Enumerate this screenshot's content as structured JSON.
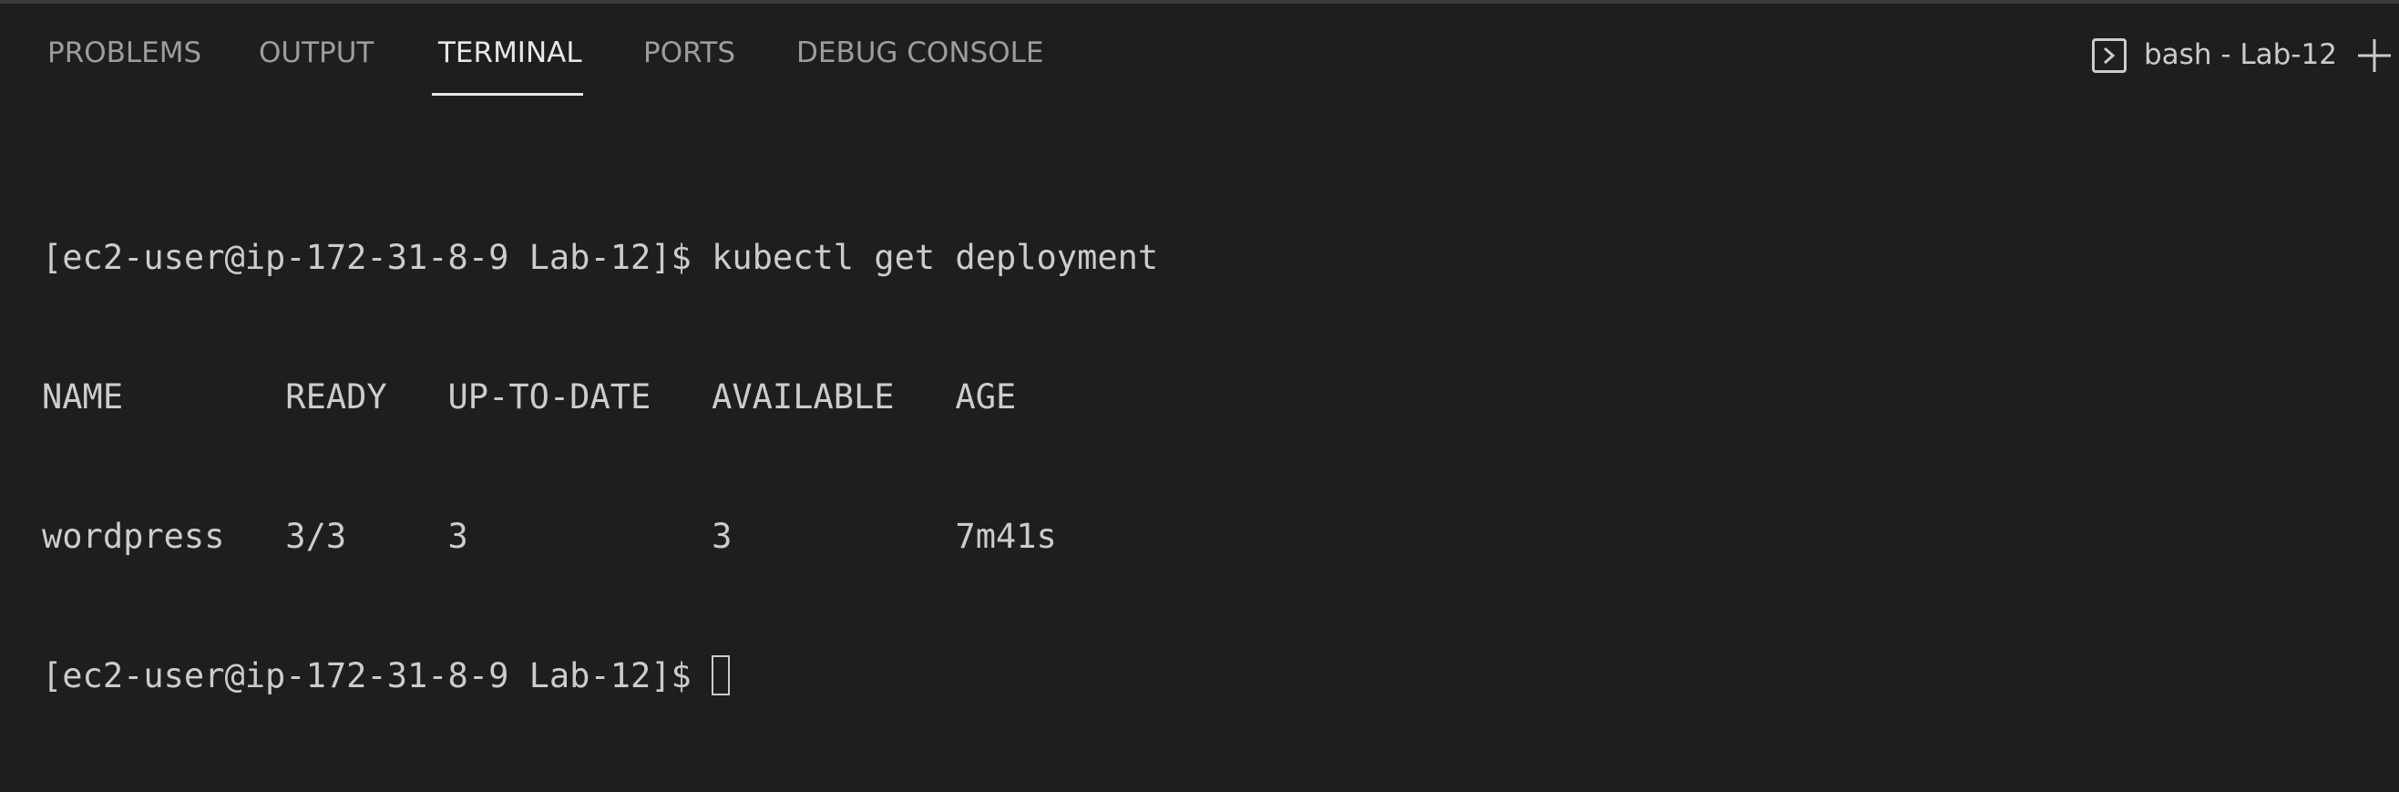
{
  "tabs": [
    {
      "label": "PROBLEMS"
    },
    {
      "label": "OUTPUT"
    },
    {
      "label": "TERMINAL"
    },
    {
      "label": "PORTS"
    },
    {
      "label": "DEBUG CONSOLE"
    }
  ],
  "active_tab": "TERMINAL",
  "terminal_instance": {
    "title": "bash - Lab-12",
    "icon": "terminal-icon"
  },
  "new_terminal_icon": "plus-icon",
  "terminal": {
    "prompt1": "[ec2-user@ip-172-31-8-9 Lab-12]$ ",
    "command1": "kubectl get deployment",
    "header": "NAME        READY   UP-TO-DATE   AVAILABLE   AGE",
    "row1": "wordpress   3/3     3            3           7m41s",
    "prompt2": "[ec2-user@ip-172-31-8-9 Lab-12]$ "
  },
  "colors": {
    "background": "#1e1e1e",
    "text": "#cccccc",
    "tab_inactive": "#9d9d9d",
    "tab_active": "#e7e7e7"
  }
}
